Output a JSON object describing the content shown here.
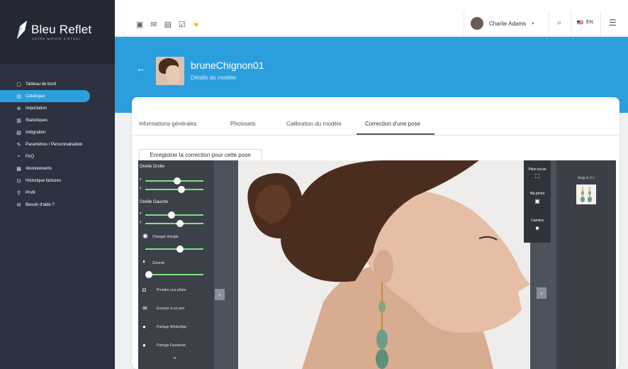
{
  "brand": {
    "name": "Bleu Reflet",
    "tagline": "VOTRE MIROIR VIRTUEL"
  },
  "sidebar": {
    "items": [
      {
        "icon": "▢",
        "label": "Tableau de bord",
        "active": false
      },
      {
        "icon": "▤",
        "label": "Catalogue",
        "active": true
      },
      {
        "icon": "⊕",
        "label": "Importation",
        "active": false
      },
      {
        "icon": "▥",
        "label": "Statistiques",
        "active": false
      },
      {
        "icon": "▧",
        "label": "Intégration",
        "active": false
      },
      {
        "icon": "✎",
        "label": "Paramètres / Personnalisation",
        "active": false
      },
      {
        "icon": "⌕",
        "label": "FAQ",
        "active": false
      },
      {
        "icon": "▦",
        "label": "Abonnements",
        "active": false
      },
      {
        "icon": "⊡",
        "label": "Historique factures",
        "active": false
      },
      {
        "icon": "⚲",
        "label": "Profil",
        "active": false
      },
      {
        "icon": "✉",
        "label": "Besoin d'aide ?",
        "active": false
      }
    ]
  },
  "topbar": {
    "user_name": "Charlie Adams",
    "language": "EN"
  },
  "header": {
    "model_name": "bruneChignon01",
    "subtitle": "Détails du modèle"
  },
  "tabs": [
    {
      "label": "Informations générales"
    },
    {
      "label": "Photosets"
    },
    {
      "label": "Calibration du modèle"
    },
    {
      "label": "Correction d'une pose"
    }
  ],
  "save_tab": "Enregistrer la correction pour cette pose",
  "controls": {
    "right_ear": "Oreille Droite",
    "left_ear": "Oreille Gauche",
    "x": "x",
    "y": "y",
    "change_angle": "Changer d'angle",
    "zoom": "Zoomer",
    "take_photo": "Prendre une photo",
    "send_friend": "Envoyer à un ami",
    "share_whatsapp": "Partage WhatsApp",
    "share_facebook": "Partage Facebook"
  },
  "tools": {
    "fullscreen": "Plein écran",
    "my_photo": "Ma photo",
    "camera": "Caméra"
  },
  "jewel": {
    "label": "long or 3 c"
  },
  "colors": {
    "accent": "#2b9fde",
    "sidebar": "#2c323f",
    "slider": "#7ee37e"
  }
}
